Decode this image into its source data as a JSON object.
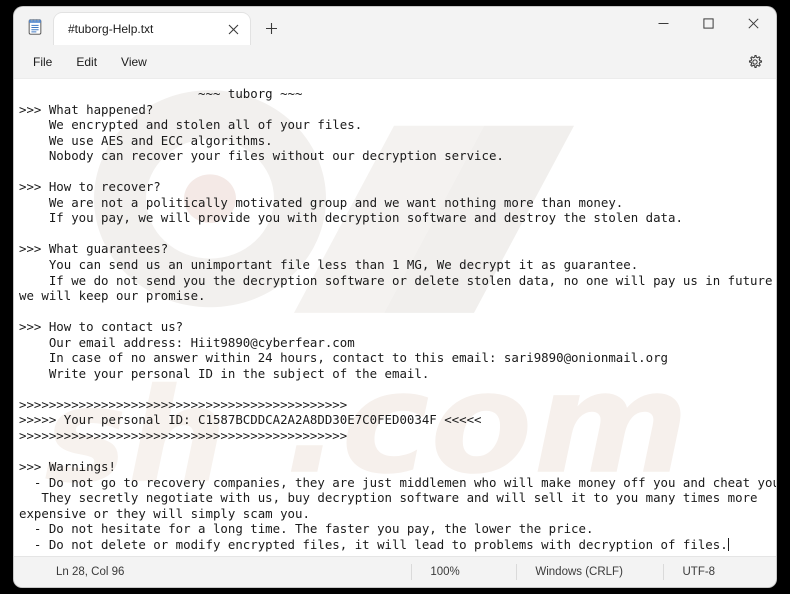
{
  "window": {
    "app_icon": "notepad-icon",
    "tab": {
      "title": "#tuborg-Help.txt",
      "close_icon": "close-icon"
    },
    "new_tab_icon": "plus-icon",
    "controls": {
      "minimize_icon": "minimize-icon",
      "maximize_icon": "maximize-icon",
      "close_icon": "close-icon"
    }
  },
  "menubar": {
    "items": [
      {
        "label": "File"
      },
      {
        "label": "Edit"
      },
      {
        "label": "View"
      }
    ],
    "settings_icon": "gear-icon"
  },
  "editor": {
    "content": "                        ~~~ tuborg ~~~\n>>> What happened?\n    We encrypted and stolen all of your files.\n    We use AES and ECC algorithms.\n    Nobody can recover your files without our decryption service.\n\n>>> How to recover?\n    We are not a politically motivated group and we want nothing more than money.\n    If you pay, we will provide you with decryption software and destroy the stolen data.\n\n>>> What guarantees?\n    You can send us an unimportant file less than 1 MG, We decrypt it as guarantee.\n    If we do not send you the decryption software or delete stolen data, no one will pay us in future so\nwe will keep our promise.\n\n>>> How to contact us?\n    Our email address: Hiit9890@cyberfear.com\n    In case of no answer within 24 hours, contact to this email: sari9890@onionmail.org\n    Write your personal ID in the subject of the email.\n\n>>>>>>>>>>>>>>>>>>>>>>>>>>>>>>>>>>>>>>>>>>>>\n>>>>> Your personal ID: C1587BCDDCA2A2A8DD30E7C0FED0034F <<<<<\n>>>>>>>>>>>>>>>>>>>>>>>>>>>>>>>>>>>>>>>>>>>>\n\n>>> Warnings!\n  - Do not go to recovery companies, they are just middlemen who will make money off you and cheat you.\n   They secretly negotiate with us, buy decryption software and will sell it to you many times more\nexpensive or they will simply scam you.\n  - Do not hesitate for a long time. The faster you pay, the lower the price.\n  - Do not delete or modify encrypted files, it will lead to problems with decryption of files.",
    "watermark_text": ".com",
    "ransom_note": {
      "title": "~~~ tuborg ~~~",
      "personal_id": "C1587BCDDCA2A2A8DD30E7C0FED0034F",
      "email_primary": "Hiit9890@cyberfear.com",
      "email_secondary": "sari9890@onionmail.org",
      "response_window": "24 hours",
      "test_file_limit": "1 MG",
      "encryption": "AES and ECC"
    }
  },
  "statusbar": {
    "position": "Ln 28, Col 96",
    "zoom": "100%",
    "line_ending": "Windows (CRLF)",
    "encoding": "UTF-8"
  },
  "colors": {
    "window_chrome": "#f3f3f3",
    "editor_bg": "#ffffff",
    "text": "#1a1a1a",
    "desktop": "#000000"
  }
}
